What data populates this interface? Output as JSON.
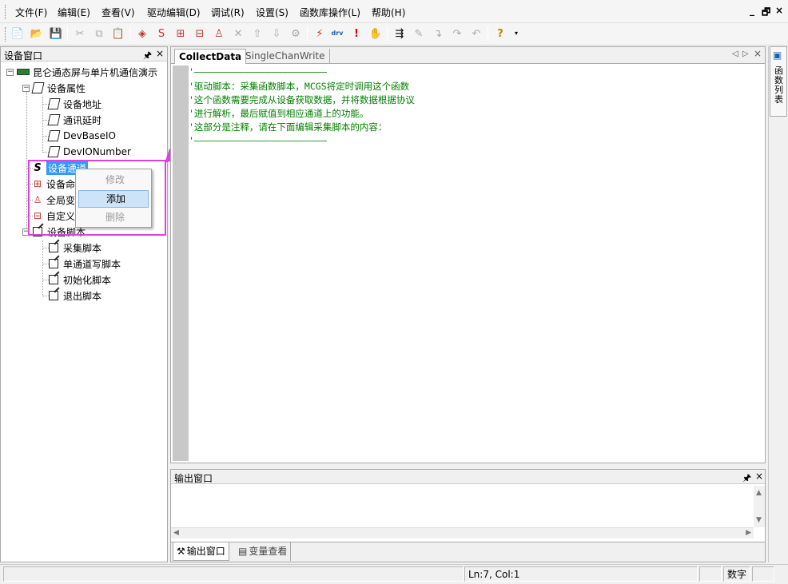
{
  "menu": {
    "items": [
      "文件(F)",
      "编辑(E)",
      "查看(V)",
      "驱动编辑(D)",
      "调试(R)",
      "设置(S)",
      "函数库操作(L)",
      "帮助(H)"
    ],
    "minimize": "_",
    "restore": "🗗",
    "close": "×"
  },
  "toolbar": {
    "drv_label": "drv",
    "help_glyph": "?"
  },
  "left_panel": {
    "title": "设备窗口",
    "pin": "🖈",
    "close": "×",
    "tree": {
      "root": "昆仑通态屏与单片机通信演示",
      "device_props": "设备属性",
      "prop_children": [
        "设备地址",
        "通讯延时",
        "DevBaseIO",
        "DevIONumber"
      ],
      "channel": "设备通道",
      "device_cmd": "设备命",
      "global_var": "全局变",
      "custom": "自定义",
      "scripts": "设备脚本",
      "script_children": [
        "采集脚本",
        "单通道写脚本",
        "初始化脚本",
        "退出脚本"
      ]
    }
  },
  "context_menu": {
    "modify": "修改",
    "add": "添加",
    "delete": "删除"
  },
  "editor": {
    "tabs": [
      "CollectData",
      "SingleChanWrite"
    ],
    "nav_left": "◁",
    "nav_right": "▷",
    "close": "×",
    "lines": [
      "'————————————————————————",
      "'驱动脚本：采集函数脚本，MCGS将定时调用这个函数",
      "'这个函数需要完成从设备获取数据，并将数据根据协议",
      "'进行解析，最后赋值到相应通道上的功能。",
      "'这部分是注释，请在下面编辑采集脚本的内容：",
      "'————————————————————————"
    ]
  },
  "right_sidebar": {
    "func_list": "函数列表"
  },
  "output": {
    "title": "输出窗口",
    "pin": "🖈",
    "close": "×",
    "tabs": [
      "输出窗口",
      "变量查看"
    ]
  },
  "statusbar": {
    "position": "Ln:7, Col:1",
    "num": "数字"
  }
}
